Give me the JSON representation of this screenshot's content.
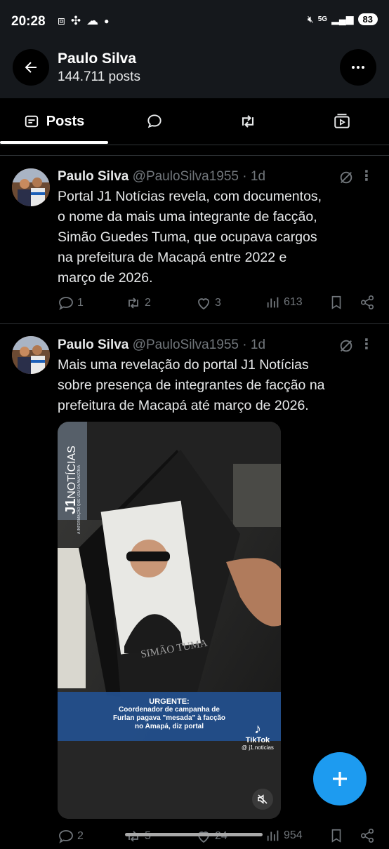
{
  "status_bar": {
    "time": "20:28",
    "network": "5G",
    "battery": "83"
  },
  "header": {
    "name": "Paulo Silva",
    "posts_count": "144.711 posts"
  },
  "tabs": [
    {
      "label": "Posts",
      "active": true,
      "icon": "posts-icon"
    },
    {
      "label": "",
      "icon": "replies-icon"
    },
    {
      "label": "",
      "icon": "reposts-icon"
    },
    {
      "label": "",
      "icon": "media-icon"
    }
  ],
  "tweets": [
    {
      "name": "Paulo Silva",
      "handle": "@PauloSilva1955",
      "time": "· 1d",
      "text_lines": [
        "Portal J1 Notícias revela, com documentos,",
        "o nome da mais uma integrante de facção,",
        "Simão Guedes Tuma, que ocupava cargos",
        "na prefeitura de Macapá entre 2022 e",
        "março de 2026."
      ],
      "replies": "1",
      "reposts": "2",
      "likes": "3",
      "views": "613"
    },
    {
      "name": "Paulo Silva",
      "handle": "@PauloSilva1955",
      "time": "· 1d",
      "text_lines": [
        "Mais uma revelação do portal J1 Notícias",
        "sobre presença de integrantes de facção na",
        "prefeitura de Macapá até março de 2026."
      ],
      "media": {
        "brand": "J1",
        "brand_word": "NOTÍCIAS",
        "tagline": "A INFORMAÇÃO QUE VEM DA AMAZÔNIA",
        "caption_name": "SIMÃO TUMA",
        "banner_title": "URGENTE:",
        "banner_lines": [
          "Coordenador de campanha de",
          "Furlan pagava \"mesada\" à facção",
          "no Amapá, diz portal"
        ],
        "tiktok_label": "TikTok",
        "tiktok_handle": "@ j1.noticias"
      },
      "replies": "2",
      "reposts": "5",
      "likes": "24",
      "views": "954"
    }
  ],
  "colors": {
    "accent": "#1d9bf0",
    "muted": "#71767b",
    "text": "#e7e9ea",
    "divider": "#2f3336"
  }
}
